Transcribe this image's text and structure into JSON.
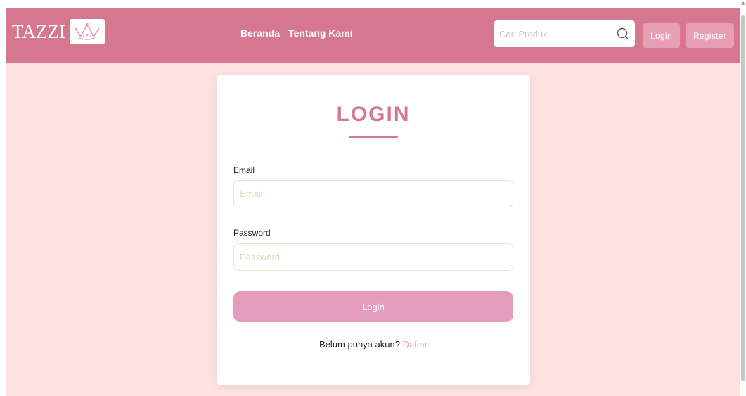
{
  "navbar": {
    "brand": "TAZZI",
    "logo_icon": "crown-icon",
    "links": [
      "Beranda",
      "Tentang Kami"
    ],
    "search_placeholder": "Cari Produk",
    "search_icon": "search-icon",
    "login_label": "Login",
    "register_label": "Register"
  },
  "login_card": {
    "title": "LOGIN",
    "email_label": "Email",
    "email_placeholder": "Email",
    "password_label": "Password",
    "password_placeholder": "Password",
    "submit_label": "Login",
    "no_account_text": "Belum punya akun? ",
    "register_link": "Daftar"
  },
  "colors": {
    "navbar": "#d4778f",
    "page_background": "#fde2e0",
    "accent": "#e59bbc"
  }
}
